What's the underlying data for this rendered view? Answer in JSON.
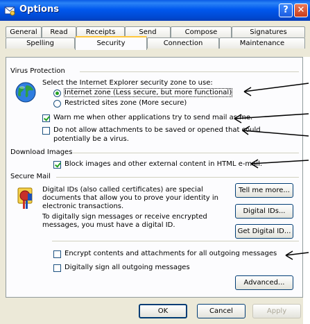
{
  "window": {
    "title": "Options"
  },
  "tabs_row1": [
    "General",
    "Read",
    "Receipts",
    "Send",
    "Compose",
    "Signatures"
  ],
  "tabs_row2": [
    "Spelling",
    "Security",
    "Connection",
    "Maintenance"
  ],
  "virus": {
    "heading": "Virus Protection",
    "zone_prompt": "Select the Internet Explorer security zone to use:",
    "zone_internet": "Internet zone (Less secure, but more functional)",
    "zone_restricted": "Restricted sites zone (More secure)",
    "warn_label": "Warn me when other applications try to send mail as me.",
    "noattach_line1": "Do not allow attachments to be saved or opened that could",
    "noattach_line2": "potentially be a virus."
  },
  "download": {
    "heading": "Download Images",
    "block_label": "Block images and other external content in HTML e-mail."
  },
  "secure": {
    "heading": "Secure Mail",
    "desc1_line1": "Digital IDs (also called certificates) are special",
    "desc1_line2": "documents that allow you to prove your identity in",
    "desc1_line3": "electronic transactions.",
    "desc2_line1": "To digitally sign messages or receive encrypted",
    "desc2_line2": "messages, you must have a digital ID.",
    "tell_more": "Tell me more...",
    "digital_ids": "Digital IDs...",
    "get_id": "Get Digital ID...",
    "encrypt_label": "Encrypt contents and attachments for all outgoing messages",
    "sign_label": "Digitally sign all outgoing messages",
    "advanced": "Advanced..."
  },
  "footer": {
    "ok": "OK",
    "cancel": "Cancel",
    "apply": "Apply"
  },
  "state": {
    "zone": "internet",
    "warn_checked": true,
    "noattach_checked": false,
    "block_checked": true,
    "encrypt_checked": false,
    "sign_checked": false
  }
}
